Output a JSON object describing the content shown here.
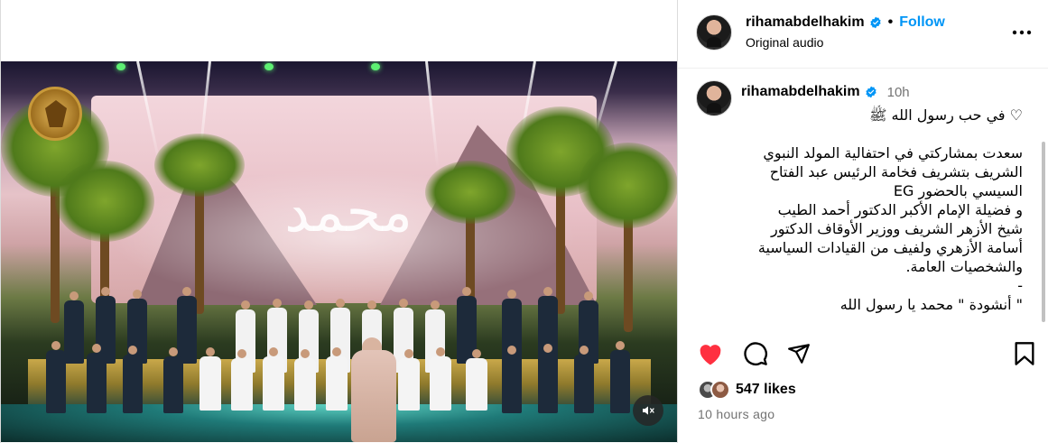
{
  "post": {
    "username": "rihamabdelhakim",
    "follow_label": "Follow",
    "dot": "•",
    "audio_label": "Original audio",
    "caption_time": "10h",
    "caption_lines": "♡ في حب رسول الله ﷺ\n\nسعدت بمشاركتي في احتفالية المولد النبوي\nالشريف بتشريف فخامة الرئيس عبد الفتاح\nالسيسي بالحضور EG\nو فضيلة الإمام الأكبر الدكتور أحمد الطيب\nشيخ الأزهر الشريف ووزير الأوقاف الدكتور\nأسامة الأزهري ولفيف من القيادات السياسية\nوالشخصيات العامة.\n-\n\" أنشودة \" محمد يا رسول الله",
    "likes_label": "547 likes",
    "time_ago": "10 hours ago",
    "liked": true
  },
  "video": {
    "overlay_text": "محمد",
    "muted": true
  },
  "colors": {
    "follow": "#0095f6",
    "verified": "#0095f6",
    "like_red": "#ff3040",
    "muted_text": "#737373"
  },
  "icons": {
    "verified": "verified-badge-icon",
    "more": "more-options-icon",
    "like": "heart-filled-icon",
    "comment": "comment-icon",
    "share": "share-icon",
    "save": "bookmark-icon",
    "mute": "speaker-muted-icon",
    "caption_heart": "heart-outline-icon"
  }
}
